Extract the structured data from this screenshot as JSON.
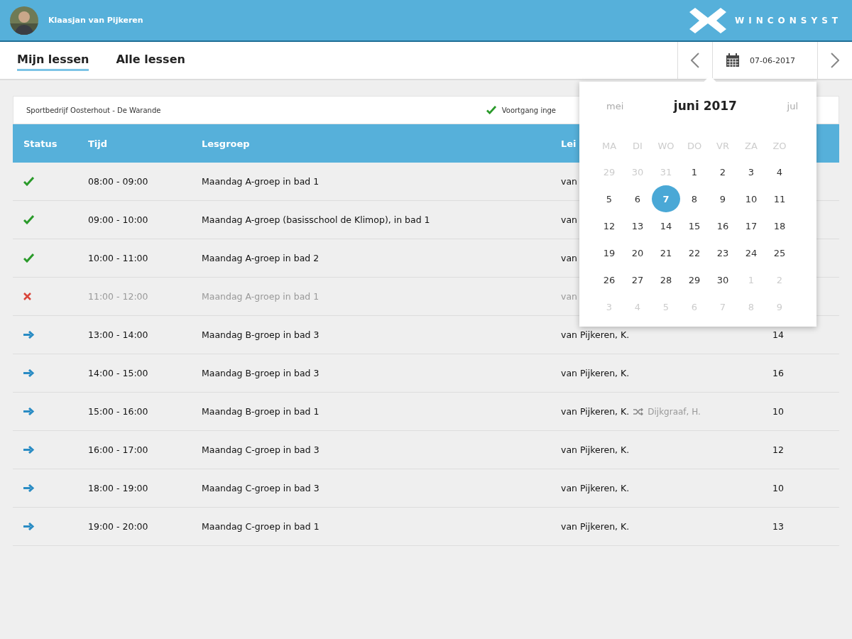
{
  "user": {
    "name": "Klaasjan van Pijkeren"
  },
  "logo": {
    "text": "WINCONSYST"
  },
  "tabs": [
    {
      "label": "Mijn lessen",
      "selected": true
    },
    {
      "label": "Alle lessen",
      "selected": false
    }
  ],
  "date_picker": {
    "value": "07-06-2017"
  },
  "info_bar": {
    "location": "Sportbedrijf Oosterhout - De Warande",
    "progress": "Voortgang inge"
  },
  "table": {
    "columns": [
      "Status",
      "Tijd",
      "Lesgroep",
      "Lei"
    ],
    "rows": [
      {
        "kind": "done",
        "time": "08:00 - 09:00",
        "group": "Maandag A-groep in bad 1",
        "leader": "van"
      },
      {
        "kind": "done",
        "time": "09:00 - 10:00",
        "group": "Maandag A-groep (basisschool de Klimop), in bad 1",
        "leader": "van"
      },
      {
        "kind": "done",
        "time": "10:00 - 11:00",
        "group": "Maandag A-groep in bad 2",
        "leader": "van"
      },
      {
        "kind": "cancelled",
        "time": "11:00 - 12:00",
        "group": "Maandag A-groep in bad 1",
        "leader": "van"
      },
      {
        "kind": "upcoming",
        "time": "13:00 - 14:00",
        "group": "Maandag B-groep in bad 3",
        "leader": "van Pijkeren, K.",
        "count": "14"
      },
      {
        "kind": "upcoming",
        "time": "14:00 - 15:00",
        "group": "Maandag B-groep in bad 3",
        "leader": "van Pijkeren, K.",
        "count": "16"
      },
      {
        "kind": "upcoming",
        "time": "15:00 - 16:00",
        "group": "Maandag B-groep in bad 1",
        "leader": "van Pijkeren, K.",
        "substitute": "Dijkgraaf, H.",
        "count": "10"
      },
      {
        "kind": "upcoming",
        "time": "16:00 - 17:00",
        "group": "Maandag C-groep in bad 3",
        "leader": "van Pijkeren, K.",
        "count": "12"
      },
      {
        "kind": "upcoming",
        "time": "18:00 - 19:00",
        "group": "Maandag C-groep in bad 3",
        "leader": "van Pijkeren, K.",
        "count": "10"
      },
      {
        "kind": "upcoming",
        "time": "19:00 - 20:00",
        "group": "Maandag C-groep in bad 1",
        "leader": "van Pijkeren, K.",
        "count": "13"
      }
    ]
  },
  "calendar": {
    "prev": "mei",
    "title": "juni 2017",
    "next": "jul",
    "weekdays": [
      "MA",
      "DI",
      "WO",
      "DO",
      "VR",
      "ZA",
      "ZO"
    ],
    "weeks": [
      [
        {
          "day": "29",
          "muted": true,
          "selected": false
        },
        {
          "day": "30",
          "muted": true,
          "selected": false
        },
        {
          "day": "31",
          "muted": true,
          "selected": false
        },
        {
          "day": "1",
          "muted": false,
          "selected": false
        },
        {
          "day": "2",
          "muted": false,
          "selected": false
        },
        {
          "day": "3",
          "muted": false,
          "selected": false
        },
        {
          "day": "4",
          "muted": false,
          "selected": false
        }
      ],
      [
        {
          "day": "5",
          "muted": false,
          "selected": false
        },
        {
          "day": "6",
          "muted": false,
          "selected": false
        },
        {
          "day": "7",
          "muted": false,
          "selected": true
        },
        {
          "day": "8",
          "muted": false,
          "selected": false
        },
        {
          "day": "9",
          "muted": false,
          "selected": false
        },
        {
          "day": "10",
          "muted": false,
          "selected": false
        },
        {
          "day": "11",
          "muted": false,
          "selected": false
        }
      ],
      [
        {
          "day": "12",
          "muted": false,
          "selected": false
        },
        {
          "day": "13",
          "muted": false,
          "selected": false
        },
        {
          "day": "14",
          "muted": false,
          "selected": false
        },
        {
          "day": "15",
          "muted": false,
          "selected": false
        },
        {
          "day": "16",
          "muted": false,
          "selected": false
        },
        {
          "day": "17",
          "muted": false,
          "selected": false
        },
        {
          "day": "18",
          "muted": false,
          "selected": false
        }
      ],
      [
        {
          "day": "19",
          "muted": false,
          "selected": false
        },
        {
          "day": "20",
          "muted": false,
          "selected": false
        },
        {
          "day": "21",
          "muted": false,
          "selected": false
        },
        {
          "day": "22",
          "muted": false,
          "selected": false
        },
        {
          "day": "23",
          "muted": false,
          "selected": false
        },
        {
          "day": "24",
          "muted": false,
          "selected": false
        },
        {
          "day": "25",
          "muted": false,
          "selected": false
        }
      ],
      [
        {
          "day": "26",
          "muted": false,
          "selected": false
        },
        {
          "day": "27",
          "muted": false,
          "selected": false
        },
        {
          "day": "28",
          "muted": false,
          "selected": false
        },
        {
          "day": "29",
          "muted": false,
          "selected": false
        },
        {
          "day": "30",
          "muted": false,
          "selected": false
        },
        {
          "day": "1",
          "muted": true,
          "selected": false
        },
        {
          "day": "2",
          "muted": true,
          "selected": false
        }
      ],
      [
        {
          "day": "3",
          "muted": true,
          "selected": false
        },
        {
          "day": "4",
          "muted": true,
          "selected": false
        },
        {
          "day": "5",
          "muted": true,
          "selected": false
        },
        {
          "day": "6",
          "muted": true,
          "selected": false
        },
        {
          "day": "7",
          "muted": true,
          "selected": false
        },
        {
          "day": "8",
          "muted": true,
          "selected": false
        },
        {
          "day": "9",
          "muted": true,
          "selected": false
        }
      ]
    ]
  }
}
